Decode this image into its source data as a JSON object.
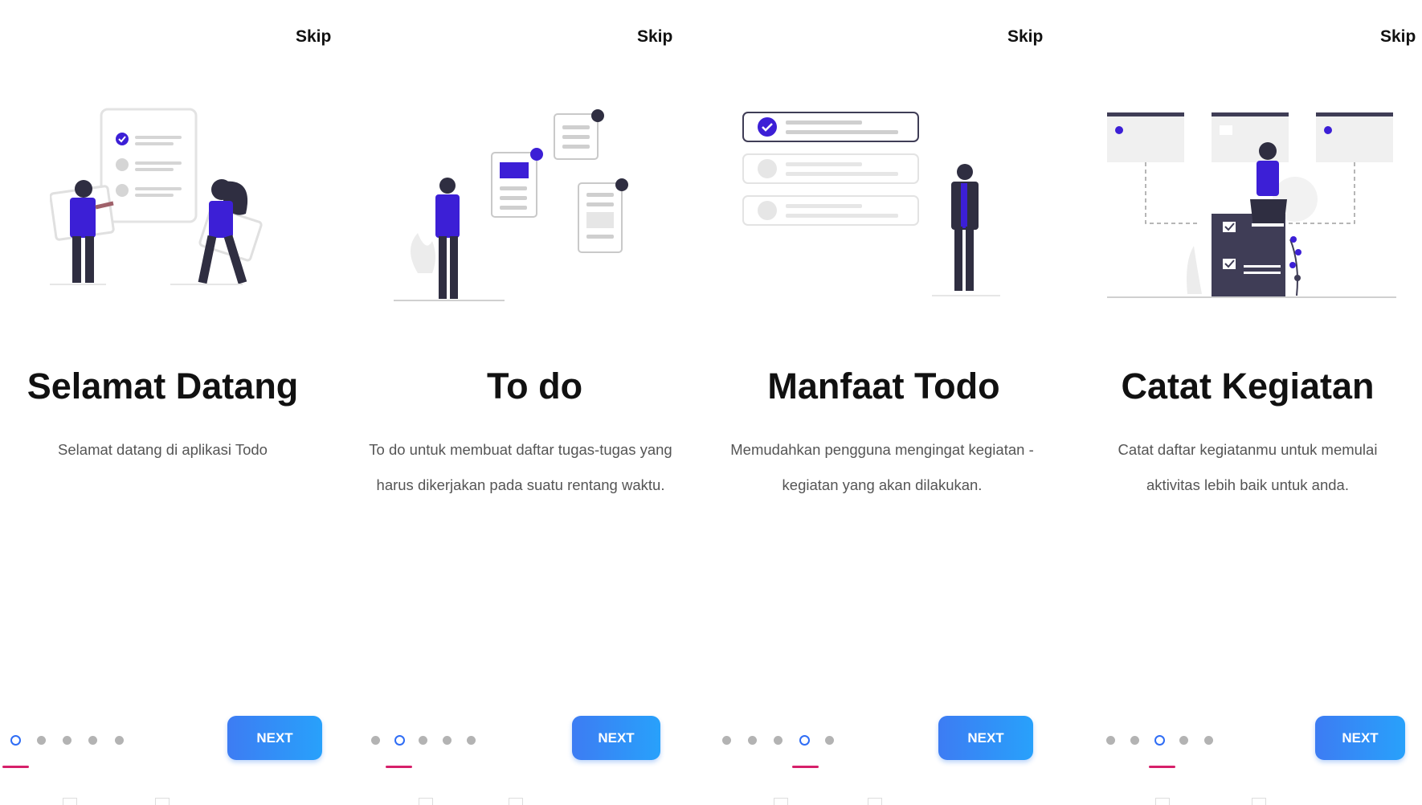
{
  "colors": {
    "accent": "#2f6df5",
    "illustration": "#3c1fd6",
    "underline": "#d6206a",
    "button": "#3d7cf3"
  },
  "screens": [
    {
      "skip": "Skip",
      "title": "Selamat Datang",
      "description": "Selamat datang di aplikasi Todo",
      "active_dot": 0,
      "dots": 5,
      "next": "NEXT"
    },
    {
      "skip": "Skip",
      "title": "To do",
      "description": "To do untuk membuat daftar tugas-tugas yang harus dikerjakan pada suatu rentang waktu.",
      "active_dot": 1,
      "dots": 5,
      "next": "NEXT"
    },
    {
      "skip": "Skip",
      "title": "Manfaat Todo",
      "description": "Memudahkan pengguna mengingat kegiatan - kegiatan yang akan dilakukan.",
      "active_dot": 3,
      "dots": 5,
      "next": "NEXT"
    },
    {
      "skip": "Skip",
      "title": "Catat Kegiatan",
      "description": "Catat daftar kegiatanmu untuk memulai aktivitas lebih baik untuk anda.",
      "active_dot": 2,
      "dots": 5,
      "next": "NEXT"
    }
  ]
}
